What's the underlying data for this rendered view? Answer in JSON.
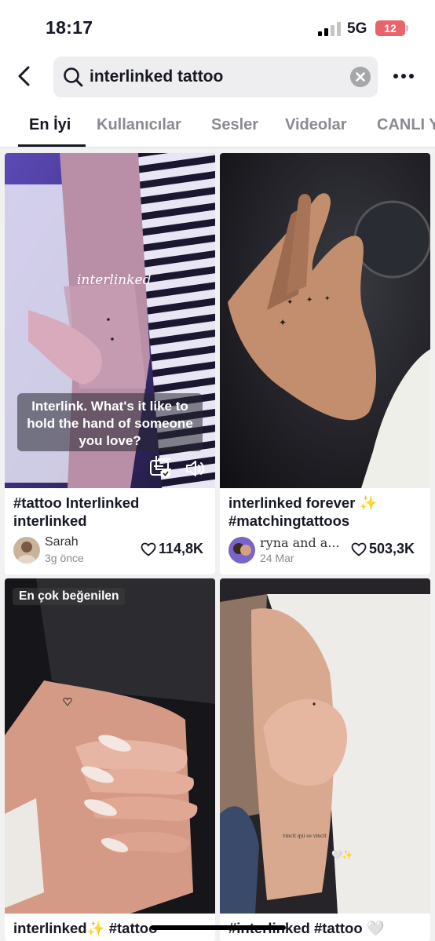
{
  "status_bar": {
    "time": "18:17",
    "network": "5G",
    "battery": "12"
  },
  "search": {
    "query": "interlinked tattoo"
  },
  "tabs": [
    "En İyi",
    "Kullanıcılar",
    "Sesler",
    "Videolar",
    "CANLI Y"
  ],
  "videos": [
    {
      "title": "#tattoo Interlinked interlinked",
      "author": "Sarah",
      "date": "3g önce",
      "likes": "114,8K",
      "overlay_word": "interlinked",
      "caption": "Interlink. What's it like to hold the hand of someone you love?"
    },
    {
      "title": "interlinked forever ✨ #matchingtattoos",
      "author": "ryna and a...",
      "date": "24 Mar",
      "likes": "503,3K"
    },
    {
      "badge": "En çok beğenilen",
      "title": "interlinked✨ #tattoo"
    },
    {
      "title": "#interlinked #tattoo 🤍"
    }
  ],
  "colors": {
    "accent_text": "#161823",
    "muted_text": "#8a8b91",
    "battery_low": "#e8646a"
  }
}
